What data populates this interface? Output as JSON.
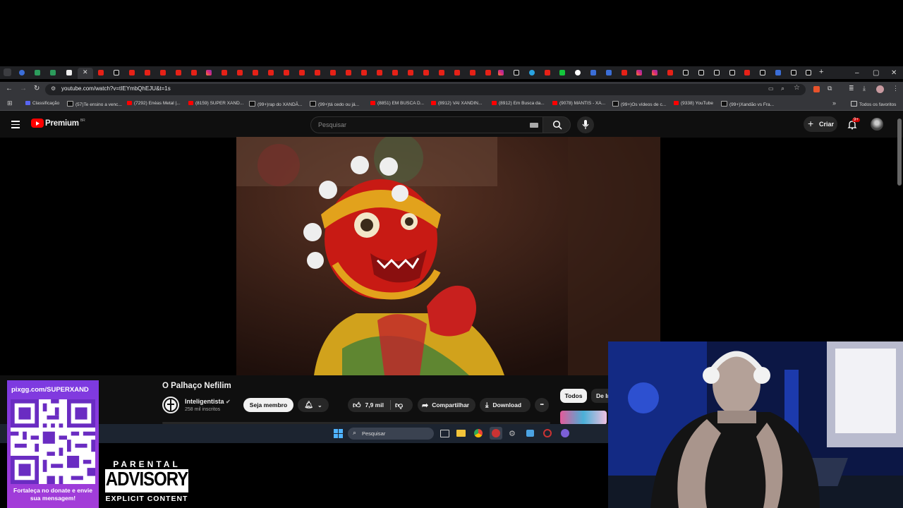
{
  "browser": {
    "url": "youtube.com/watch?v=tIEYmbQhEJU&t=1s",
    "window_controls": [
      "–",
      "▢",
      "✕"
    ],
    "new_tab": "+",
    "bookmarks": [
      {
        "label": "Classificação",
        "icon": "discord-icon"
      },
      {
        "label": "(57)Te ensino a venc...",
        "icon": "tiktok-icon"
      },
      {
        "label": "(7292) Enéas Metal |...",
        "icon": "youtube-icon"
      },
      {
        "label": "(8159) SUPER XAND...",
        "icon": "youtube-icon"
      },
      {
        "label": "(99+)rap do XANDÃ...",
        "icon": "tiktok-icon"
      },
      {
        "label": "(99+)tá cedo ou já...",
        "icon": "tiktok-icon"
      },
      {
        "label": "(8851) EM BUSCA D...",
        "icon": "youtube-icon"
      },
      {
        "label": "(8912) VAI XANDIN...",
        "icon": "youtube-icon"
      },
      {
        "label": "(8912) Em Busca da...",
        "icon": "youtube-icon"
      },
      {
        "label": "(9078) MANTIS - XA...",
        "icon": "youtube-icon"
      },
      {
        "label": "(99+)Os vídeos de c...",
        "icon": "tiktok-icon"
      },
      {
        "label": "(9338) YouTube",
        "icon": "youtube-icon"
      },
      {
        "label": "(99+)Xandão vs Fra...",
        "icon": "tiktok-icon"
      }
    ],
    "all_bookmarks": "Todos os favoritos"
  },
  "youtube": {
    "logo_text": "Premium",
    "logo_region": "BR",
    "search_placeholder": "Pesquisar",
    "create_label": "Criar",
    "notification_count": "9+",
    "video_title": "O Palhaço Nefilim",
    "channel_name": "Inteligentista",
    "subscribers": "258 mil inscritos",
    "join_label": "Seja membro",
    "likes": "7,9 mil",
    "share_label": "Compartilhar",
    "download_label": "Download",
    "more_label": "•••",
    "chip_all": "Todos",
    "chip_next": "De In"
  },
  "taskbar": {
    "search_placeholder": "Pesquisar"
  },
  "overlay": {
    "qr_url": "pixgg.com/SUPERXAND",
    "qr_caption": "Fortaleça no donate e envie sua mensagem!",
    "advisory_top": "PARENTAL",
    "advisory_middle": "ADVISORY",
    "advisory_bottom": "EXPLICIT CONTENT"
  },
  "colors": {
    "youtube_red": "#ff0000",
    "background": "#0f0f0f",
    "chrome_dark": "#202124",
    "qr_purple": "#8a3ae0"
  }
}
